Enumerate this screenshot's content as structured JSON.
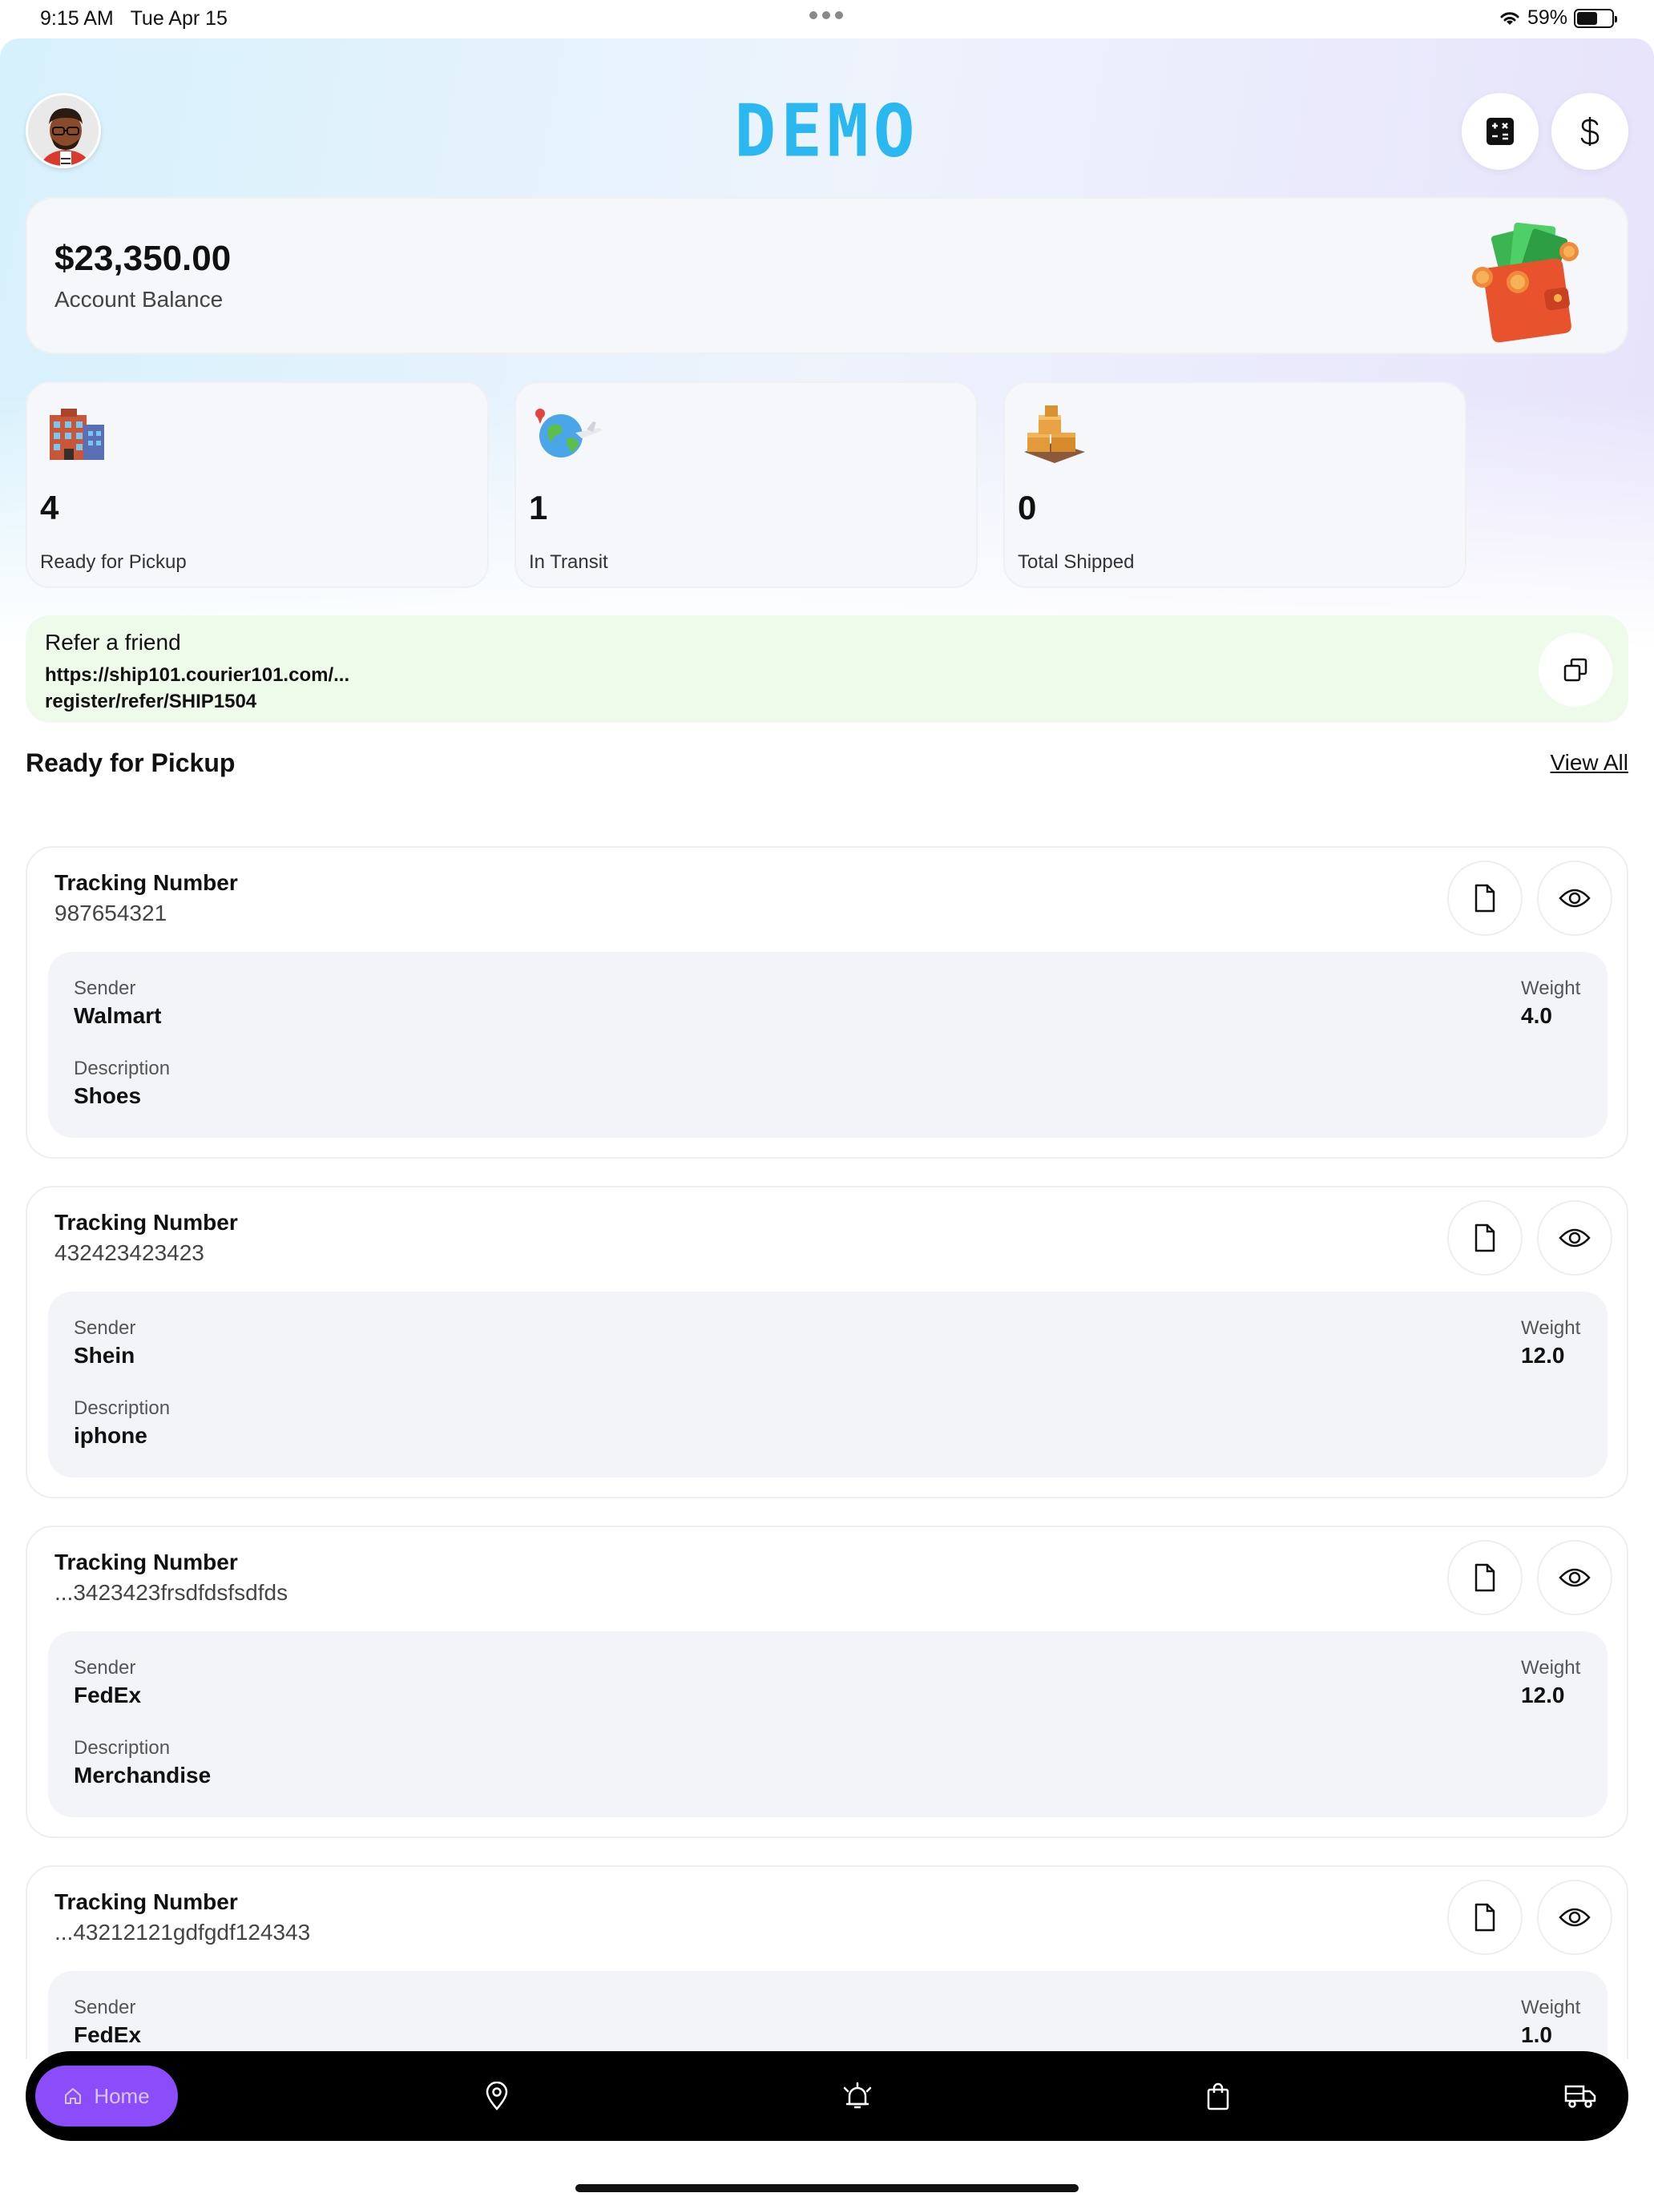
{
  "status_bar": {
    "time": "9:15 AM",
    "date": "Tue Apr 15",
    "battery": "59%",
    "battery_level": 0.59
  },
  "header": {
    "logo": "DEMO",
    "avatar_icon": "memoji-avatar",
    "calculator_icon": "calculator-icon",
    "currency_icon": "dollar-icon"
  },
  "balance": {
    "amount": "$23,350.00",
    "label": "Account Balance",
    "illustration": "wallet-money-icon"
  },
  "stats": [
    {
      "value": "4",
      "label": "Ready for Pickup",
      "icon": "building-icon"
    },
    {
      "value": "1",
      "label": "In Transit",
      "icon": "globe-plane-icon"
    },
    {
      "value": "0",
      "label": "Total Shipped",
      "icon": "boxes-icon"
    }
  ],
  "refer": {
    "title": "Refer a friend",
    "link_line1": "https://ship101.courier101.com/...",
    "link_line2": "register/refer/SHIP1504"
  },
  "section": {
    "title": "Ready for Pickup",
    "view_all": "View All"
  },
  "labels": {
    "tracking": "Tracking Number",
    "sender": "Sender",
    "weight": "Weight",
    "description": "Description"
  },
  "packages": [
    {
      "tracking": "987654321",
      "sender": "Walmart",
      "weight": "4.0",
      "description": "Shoes"
    },
    {
      "tracking": "432423423423",
      "sender": "Shein",
      "weight": "12.0",
      "description": "iphone"
    },
    {
      "tracking": "...3423423frsdfdsfsdfds",
      "sender": "FedEx",
      "weight": "12.0",
      "description": "Merchandise"
    },
    {
      "tracking": "...43212121gdfgdf124343",
      "sender": "FedEx",
      "weight": "1.0",
      "description": ""
    }
  ],
  "nav": {
    "home": "Home",
    "items": [
      "home-icon",
      "location-pin-icon",
      "alarm-bell-icon",
      "shopping-bag-icon",
      "delivery-truck-icon"
    ],
    "accent": "#8b4dfa"
  },
  "colors": {
    "logo": "#2bb7f0",
    "refer_bg": "#eefbea",
    "nav_bg": "#000000"
  }
}
